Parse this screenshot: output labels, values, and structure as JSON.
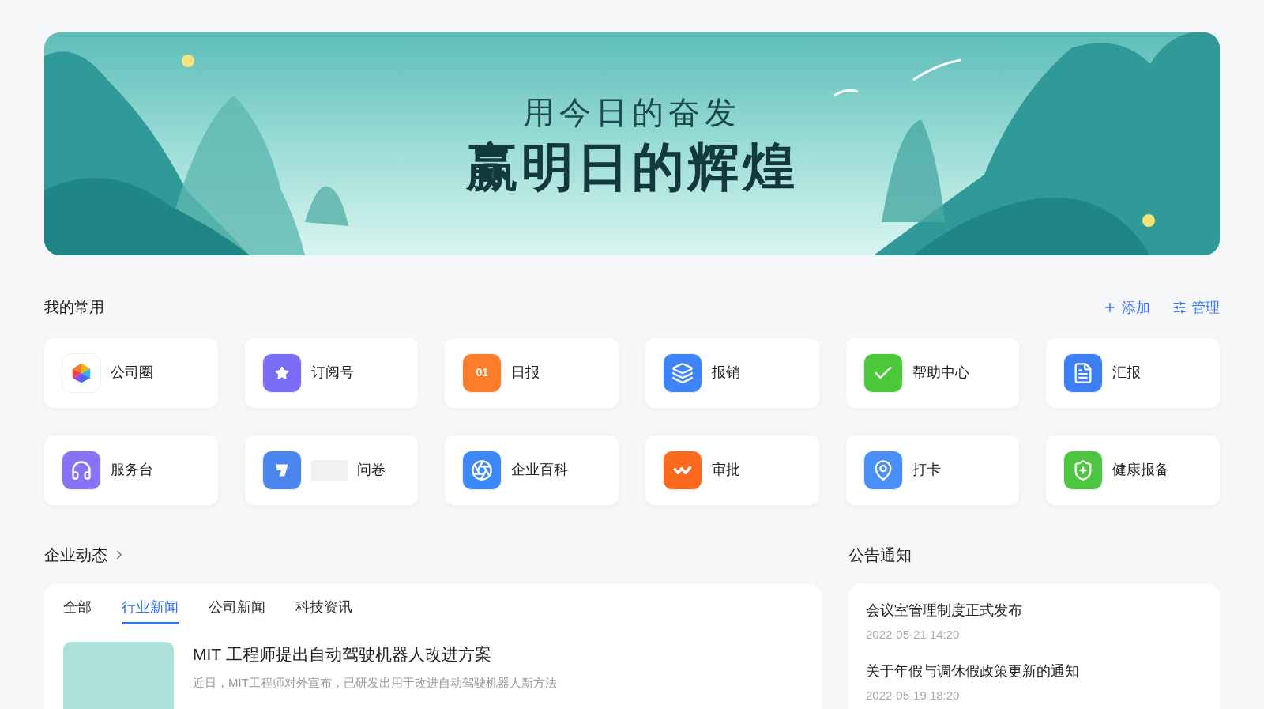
{
  "banner": {
    "line_1": "用今日的奋发",
    "line_2": "赢明日的辉煌"
  },
  "favorites": {
    "title": "我的常用",
    "actions": [
      "添加",
      "管理"
    ],
    "items": [
      {
        "label": "公司圈",
        "color": "#ffffff",
        "redacted": false
      },
      {
        "label": "订阅号",
        "color": "#7b6cf6",
        "redacted": false
      },
      {
        "label": "日报",
        "color": "#fb7d2a",
        "redacted": false,
        "icon_text": "01"
      },
      {
        "label": "报销",
        "color": "#3d84f7",
        "redacted": false
      },
      {
        "label": "帮助中心",
        "color": "#4cc93a",
        "redacted": false
      },
      {
        "label": "汇报",
        "color": "#3d7ef5",
        "redacted": false
      },
      {
        "label": "服务台",
        "color": "#8a72f7",
        "redacted": false
      },
      {
        "label": "问卷",
        "color": "#4b86ef",
        "redacted": true
      },
      {
        "label": "企业百科",
        "color": "#3d88f8",
        "redacted": false
      },
      {
        "label": "审批",
        "color": "#fb6a1c",
        "redacted": false
      },
      {
        "label": "打卡",
        "color": "#4a8ef7",
        "redacted": false
      },
      {
        "label": "健康报备",
        "color": "#4cc640",
        "redacted": false
      }
    ]
  },
  "news": {
    "title": "企业动态",
    "tabs": [
      {
        "label": "全部",
        "selected": false
      },
      {
        "label": "行业新闻",
        "selected": true
      },
      {
        "label": "公司新闻",
        "selected": false
      },
      {
        "label": "科技资讯",
        "selected": false
      }
    ],
    "items": [
      {
        "title": "MIT 工程师提出自动驾驶机器人改进方案",
        "summary": "近日，MIT工程师对外宣布，已研发出用于改进自动驾驶机器人新方法"
      }
    ]
  },
  "notices": {
    "title": "公告通知",
    "items": [
      {
        "title": "会议室管理制度正式发布",
        "time": "2022-05-21 14:20"
      },
      {
        "title": "关于年假与调休假政策更新的通知",
        "time": "2022-05-19 18:20"
      }
    ]
  }
}
